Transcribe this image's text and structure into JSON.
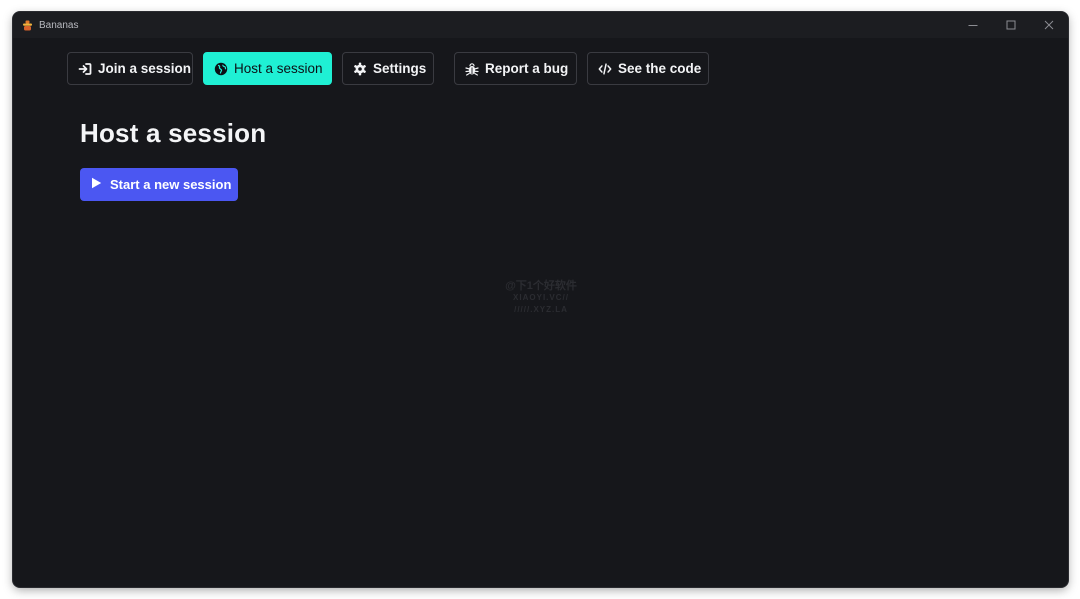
{
  "window": {
    "title": "Bananas",
    "controls": [
      "minimize-icon",
      "maximize-icon",
      "close-icon"
    ]
  },
  "nav": {
    "items": [
      {
        "label": "Join a session",
        "icon": "sign-in-icon",
        "active": false
      },
      {
        "label": "Host a session",
        "icon": "globe-icon",
        "active": true
      },
      {
        "label": "Settings",
        "icon": "gear-icon",
        "active": false
      },
      {
        "label": "Report a bug",
        "icon": "bug-icon",
        "active": false
      },
      {
        "label": "See the code",
        "icon": "code-icon",
        "active": false
      }
    ]
  },
  "main": {
    "title": "Host a session",
    "start_button_label": "Start a new session",
    "start_button_icon": "play-icon"
  },
  "watermark": {
    "line1": "@下1个好软件",
    "line2": "XIAOYI.VC//",
    "line3": "/////.XYZ.LA"
  },
  "colors": {
    "background": "#16171b",
    "active_tab": "#1ff0d4",
    "primary": "#4b57f2"
  }
}
